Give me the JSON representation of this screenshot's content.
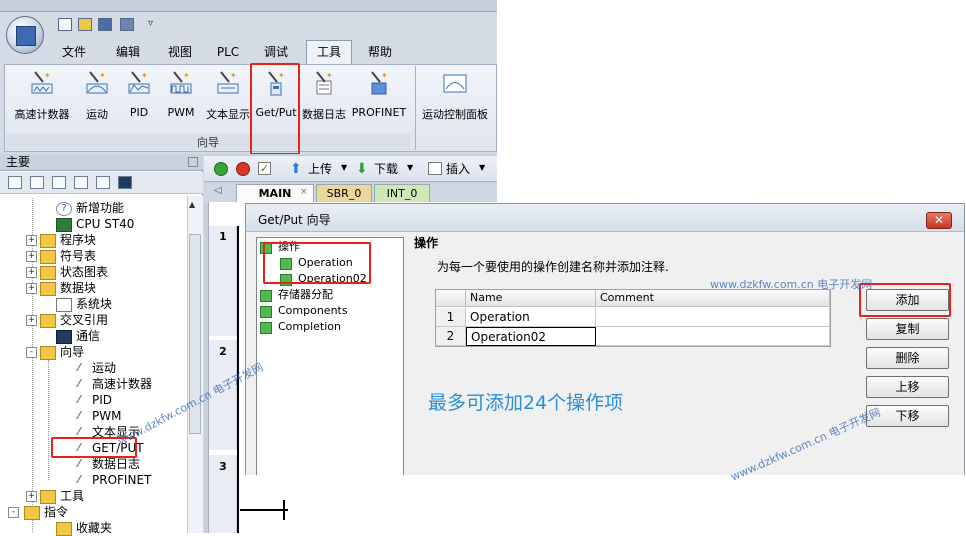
{
  "menu": {
    "tabs": [
      {
        "label": "文件"
      },
      {
        "label": "编辑"
      },
      {
        "label": "视图"
      },
      {
        "label": "PLC"
      },
      {
        "label": "调试"
      },
      {
        "label": "工具"
      },
      {
        "label": "帮助"
      }
    ],
    "active_tab": "工具"
  },
  "ribbon": {
    "wizard_group_caption": "向导",
    "buttons": [
      {
        "label": "高速计数器",
        "icon": "hsc-wand-icon"
      },
      {
        "label": "运动",
        "icon": "motion-wand-icon"
      },
      {
        "label": "PID",
        "icon": "pid-wand-icon"
      },
      {
        "label": "PWM",
        "icon": "pwm-wand-icon"
      },
      {
        "label": "文本显示",
        "icon": "text-display-wand-icon"
      },
      {
        "label": "Get/Put",
        "icon": "getput-wand-icon"
      },
      {
        "label": "数据日志",
        "icon": "datalog-wand-icon"
      },
      {
        "label": "PROFINET",
        "icon": "profinet-wand-icon"
      }
    ],
    "motion_panel_button": {
      "label": "运动控制面板",
      "icon": "motion-panel-icon"
    }
  },
  "project_tree": {
    "header": "主要",
    "items": [
      {
        "label": "新增功能",
        "icon": "help-icon",
        "indent": 2
      },
      {
        "label": "CPU ST40",
        "icon": "cpu-icon",
        "indent": 2
      },
      {
        "label": "程序块",
        "icon": "folder-icon",
        "indent": 1,
        "expander": "+"
      },
      {
        "label": "符号表",
        "icon": "folder-icon",
        "indent": 1,
        "expander": "+"
      },
      {
        "label": "状态图表",
        "icon": "folder-icon",
        "indent": 1,
        "expander": "+"
      },
      {
        "label": "数据块",
        "icon": "folder-icon",
        "indent": 1,
        "expander": "+"
      },
      {
        "label": "系统块",
        "icon": "doc-icon",
        "indent": 2
      },
      {
        "label": "交叉引用",
        "icon": "folder-icon",
        "indent": 1,
        "expander": "+"
      },
      {
        "label": "通信",
        "icon": "pc-icon",
        "indent": 2
      },
      {
        "label": "向导",
        "icon": "wizard-folder-icon",
        "indent": 1,
        "expander": "-"
      },
      {
        "label": "运动",
        "icon": "wand-icon",
        "indent": 3
      },
      {
        "label": "高速计数器",
        "icon": "wand-icon",
        "indent": 3
      },
      {
        "label": "PID",
        "icon": "wand-icon",
        "indent": 3
      },
      {
        "label": "PWM",
        "icon": "wand-icon",
        "indent": 3
      },
      {
        "label": "文本显示",
        "icon": "wand-icon",
        "indent": 3
      },
      {
        "label": "GET/PUT",
        "icon": "wand-icon",
        "indent": 3
      },
      {
        "label": "数据日志",
        "icon": "wand-icon",
        "indent": 3
      },
      {
        "label": "PROFINET",
        "icon": "wand-icon",
        "indent": 3
      },
      {
        "label": "工具",
        "icon": "folder-icon",
        "indent": 1,
        "expander": "+"
      },
      {
        "label": "指令",
        "icon": "folder-icon",
        "indent": 0,
        "expander": "-"
      },
      {
        "label": "收藏夹",
        "icon": "folder-icon",
        "indent": 2
      }
    ]
  },
  "editor": {
    "toolbar": {
      "upload": "上传",
      "download": "下载",
      "insert": "插入"
    },
    "tabs": [
      "MAIN",
      "SBR_0",
      "INT_0"
    ],
    "networks": [
      "1",
      "2",
      "3"
    ]
  },
  "dialog": {
    "title": "Get/Put 向导",
    "close": "✕",
    "nav": [
      {
        "label": "操作",
        "level": 0
      },
      {
        "label": "Operation",
        "level": 1
      },
      {
        "label": "Operation02",
        "level": 1
      },
      {
        "label": "存储器分配",
        "level": 0
      },
      {
        "label": "Components",
        "level": 0
      },
      {
        "label": "Completion",
        "level": 0
      }
    ],
    "heading": "操作",
    "description": "为每一个要使用的操作创建名称并添加注释.",
    "table": {
      "columns": [
        "",
        "Name",
        "Comment"
      ],
      "rows": [
        {
          "index": "1",
          "name": "Operation",
          "comment": ""
        },
        {
          "index": "2",
          "name": "Operation02",
          "comment": ""
        }
      ]
    },
    "tip": "最多可添加24个操作项",
    "buttons": {
      "add": "添加",
      "copy": "复制",
      "delete": "删除",
      "up": "上移",
      "down": "下移"
    }
  },
  "watermarks": [
    "www.dzkfw.com.cn 电子开发网",
    "www.dzkfw.com.cn 电子开发网",
    "www.dzkfw.com.cn 电子开发网"
  ],
  "colors": {
    "highlight": "#e8221b",
    "tip": "#2a8fd8",
    "watermark": "#2e5fb0"
  }
}
